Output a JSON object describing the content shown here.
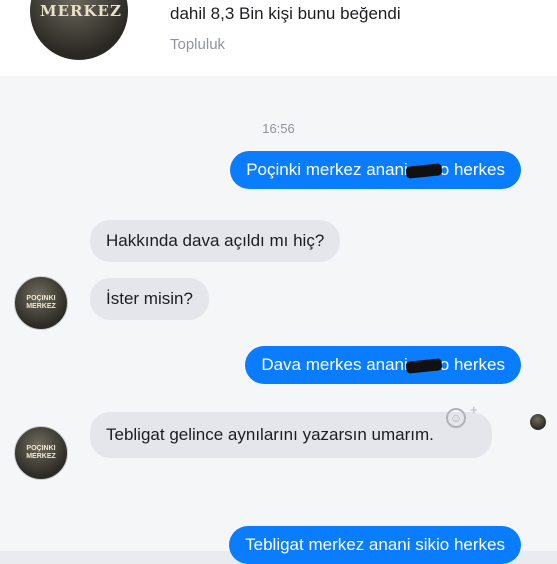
{
  "header": {
    "page_avatar_text": "MERKEZ",
    "likes_text": "dahil 8,3 Bin kişi bunu beğendi",
    "category": "Topluluk"
  },
  "chat": {
    "timestamp": "16:56",
    "messages": [
      {
        "side": "out",
        "pre": "Poçinki merkez anani",
        "post": "o herkes"
      },
      {
        "side": "in",
        "text": "Hakkında dava açıldı mı hiç?"
      },
      {
        "side": "in",
        "text": "İster misin?"
      },
      {
        "side": "out",
        "pre": "Dava merkes anani",
        "post": "o herkes"
      },
      {
        "side": "in",
        "text": "Tebligat gelince aynılarını yazarsın umarım."
      },
      {
        "side": "out",
        "pre": "Tebligat merkez anani sikio herkes"
      }
    ],
    "avatar_text": "POÇINKI MERKEZ"
  },
  "colors": {
    "outgoing_bubble": "#0a7cff",
    "incoming_bubble": "#e4e6eb"
  },
  "icons": [
    "emoji-icon",
    "seen-avatar"
  ]
}
